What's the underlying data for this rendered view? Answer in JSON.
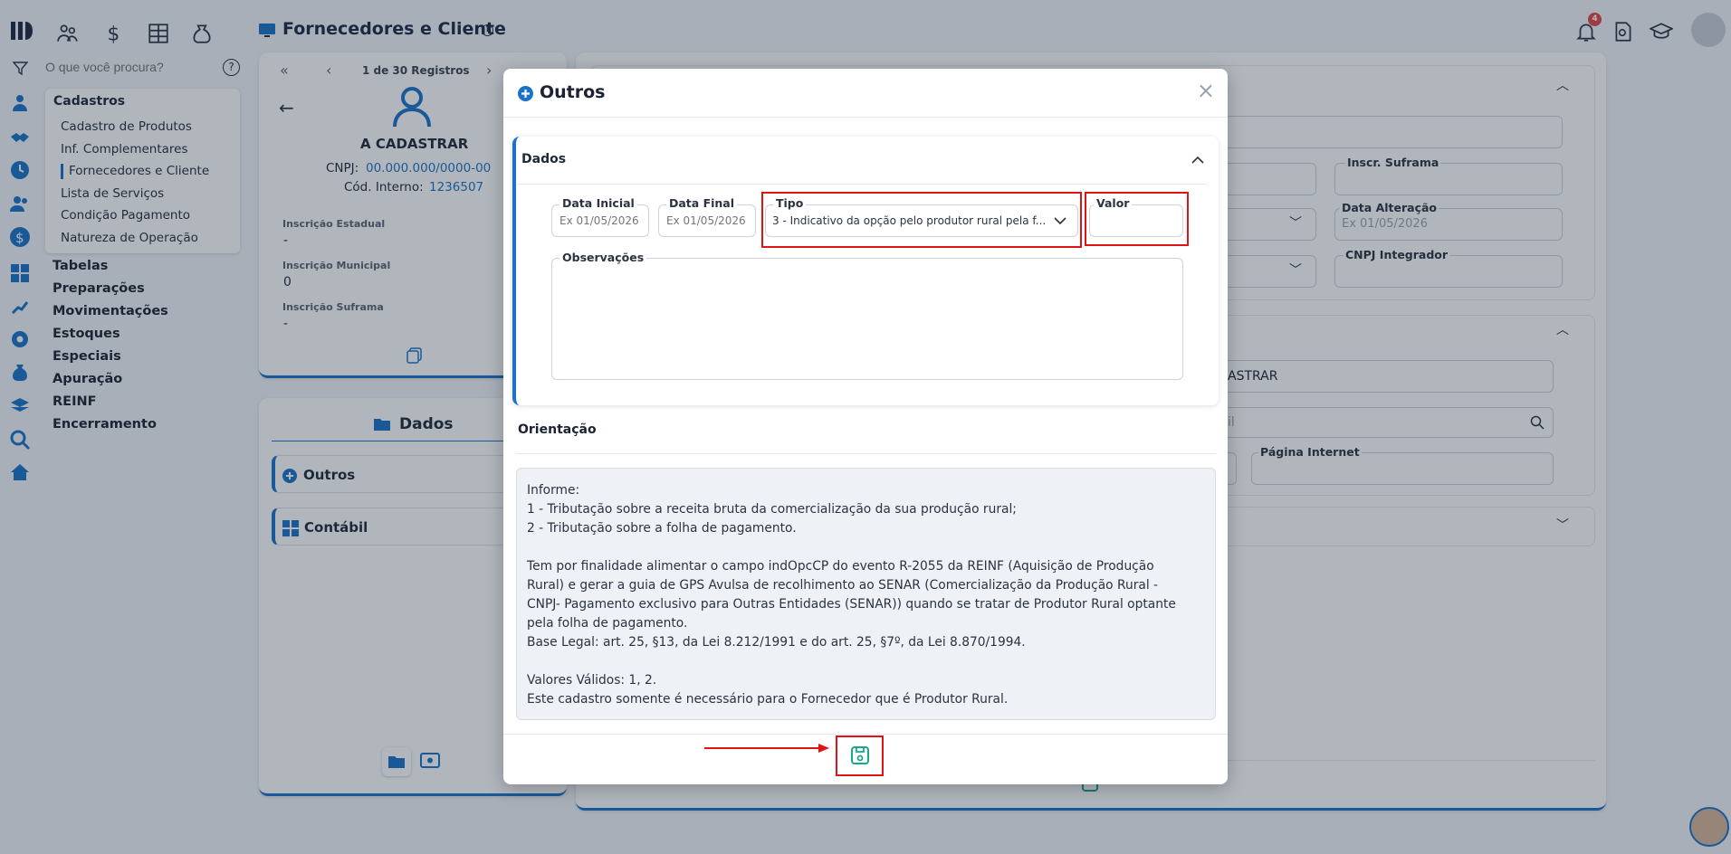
{
  "header": {
    "title": "Fornecedores e Cliente",
    "notification_count": "4"
  },
  "search": {
    "placeholder": "O que você procura?"
  },
  "menu": {
    "section": "Cadastros",
    "subitems": [
      "Cadastro de Produtos",
      "Inf. Complementares",
      "Fornecedores e Cliente",
      "Lista de Serviços",
      "Condição Pagamento",
      "Natureza de Operação"
    ],
    "items": [
      "Tabelas",
      "Preparações",
      "Movimentações",
      "Estoques",
      "Especiais",
      "Apuração",
      "REINF",
      "Encerramento"
    ]
  },
  "record": {
    "nav": "1 de 30 Registros",
    "name": "A CADASTRAR",
    "cnpj_label": "CNPJ:",
    "cnpj": "00.000.000/0000-00",
    "cod_label": "Cód. Interno:",
    "cod": "1236507",
    "fields": [
      {
        "label": "Inscrição Estadual",
        "value": "-"
      },
      {
        "label": "Inscrição Municipal",
        "value": "0"
      },
      {
        "label": "Inscrição Suframa",
        "value": "-"
      }
    ]
  },
  "dados_panel": {
    "title": "Dados",
    "items": [
      "Outros",
      "Contábil"
    ]
  },
  "bg_form": {
    "inscr_suframa": "Inscr. Suframa",
    "data_alteracao": "Data Alteração",
    "data_alteracao_ph": "Ex 01/05/2026",
    "cnpj_integrador": "CNPJ Integrador",
    "name_value": "ASTRAR",
    "email_fragment": "il",
    "pagina_internet": "Página Internet"
  },
  "modal": {
    "title": "Outros",
    "section_title": "Dados",
    "data_inicial_label": "Data Inicial",
    "data_inicial_ph": "Ex 01/05/2026",
    "data_final_label": "Data Final",
    "data_final_ph": "Ex 01/05/2026",
    "tipo_label": "Tipo",
    "tipo_value": "3 - Indicativo da opção pelo produtor rural pela f...",
    "valor_label": "Valor",
    "observacoes_label": "Observações",
    "orientacao_title": "Orientação",
    "orientacao_lines": [
      "Informe:",
      "1 - Tributação sobre a receita bruta da comercialização da sua produção rural;",
      "2 - Tributação sobre a folha de pagamento.",
      "",
      "Tem por finalidade alimentar o campo indOpcCP do evento R-2055 da REINF (Aquisição de Produção",
      "Rural) e gerar a guia de GPS Avulsa de recolhimento ao SENAR (Comercialização da Produção Rural -",
      "CNPJ- Pagamento exclusivo para Outras Entidades (SENAR)) quando se tratar de Produtor Rural optante",
      "pela folha de pagamento.",
      "Base Legal: art. 25, §13, da Lei 8.212/1991 e do art. 25, §7º, da Lei 8.870/1994.",
      "",
      "Valores Válidos: 1, 2.",
      "Este cadastro somente é necessário para o Fornecedor que é Produtor Rural."
    ]
  },
  "colors": {
    "accent": "#1a73c8",
    "annotation": "#e01414",
    "save": "#17a88a"
  }
}
